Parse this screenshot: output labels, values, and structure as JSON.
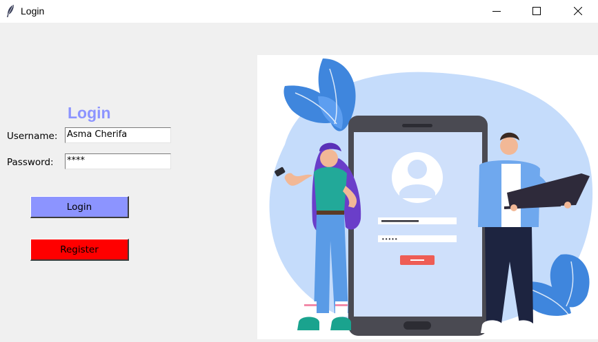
{
  "window": {
    "title": "Login",
    "icon": "feather-icon",
    "controls": [
      "minimize-icon",
      "maximize-icon",
      "close-icon"
    ]
  },
  "form": {
    "heading": "Login",
    "username_label": "Username:",
    "username_value": "Asma Cherifa",
    "password_label": "Password:",
    "password_value": "****",
    "login_label": "Login",
    "register_label": "Register"
  },
  "colors": {
    "accent": "#8c94ff",
    "register": "#ff0000",
    "illustration_blob": "#c5dcfb",
    "leaf": "#4a90e2"
  },
  "illustration": {
    "phone_password_mask": "•••••"
  }
}
